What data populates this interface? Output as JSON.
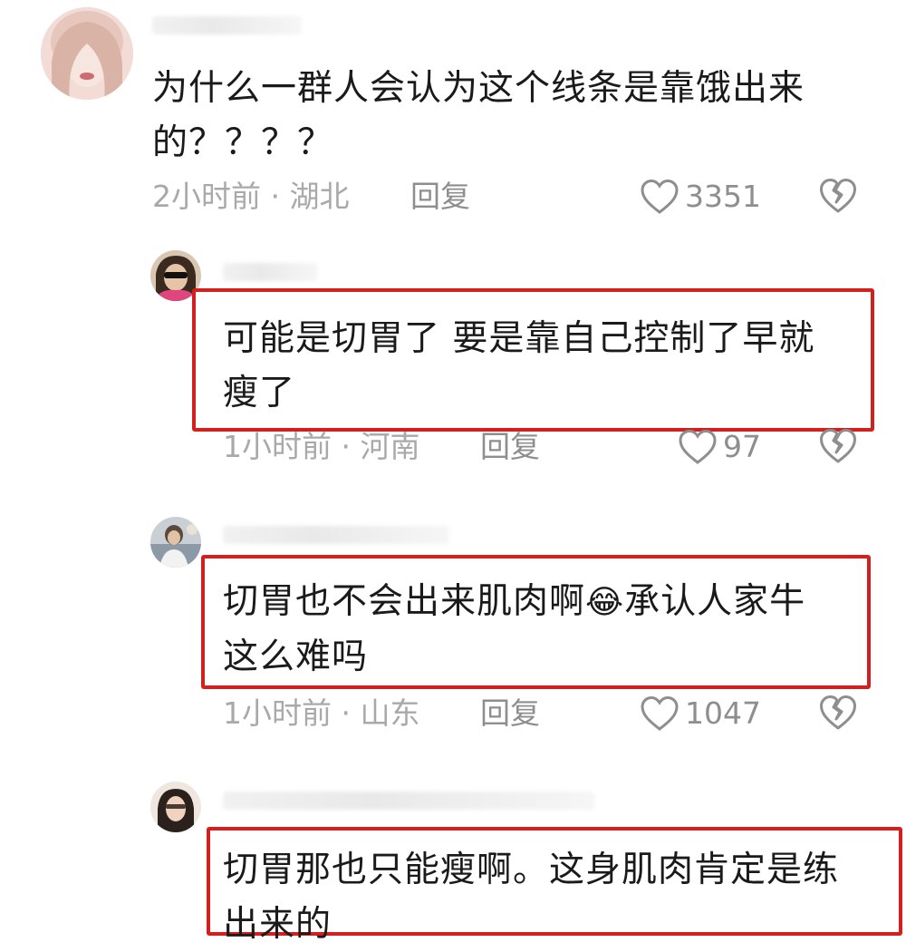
{
  "comments": [
    {
      "text_line1": "为什么一群人会认为这个线条是靠饿出来",
      "text_line2": "的？？？？",
      "time": "2小时前 · 湖北",
      "reply_label": "回复",
      "likes": "3351"
    },
    {
      "text_line1": "可能是切胃了 要是靠自己控制了早就",
      "text_line2": "瘦了",
      "time": "1小时前 · 河南",
      "reply_label": "回复",
      "likes": "97"
    },
    {
      "text_line1a": "切胃也不会出来肌肉啊",
      "text_line1b": "承认人家牛",
      "text_line2": "这么难吗",
      "emoji": "😂",
      "time": "1小时前 · 山东",
      "reply_label": "回复",
      "likes": "1047"
    },
    {
      "text_line1": "切胃那也只能瘦啊。这身肌肉肯定是练",
      "text_line2": "出来的"
    }
  ],
  "colors": {
    "highlight_border": "#d41f1f",
    "meta_text": "#a9a9a9",
    "icon_gray": "#8e8e8e"
  },
  "icons": {
    "like": "heart-outline-icon",
    "dislike": "broken-heart-icon"
  }
}
